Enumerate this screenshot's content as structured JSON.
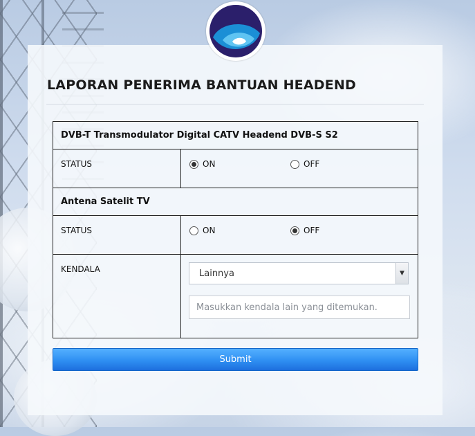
{
  "header": {
    "title": "LAPORAN PENERIMA BANTUAN HEADEND",
    "logo_icon": "kominfo-logo"
  },
  "sections": [
    {
      "title": "DVB-T Transmodulator Digital CATV Headend DVB-S S2",
      "status_label": "STATUS",
      "options": [
        {
          "label": "ON",
          "checked": true
        },
        {
          "label": "OFF",
          "checked": false
        }
      ]
    },
    {
      "title": "Antena Satelit TV",
      "status_label": "STATUS",
      "options": [
        {
          "label": "ON",
          "checked": false
        },
        {
          "label": "OFF",
          "checked": true
        }
      ],
      "kendala_label": "KENDALA",
      "kendala_select_value": "Lainnya",
      "kendala_input_placeholder": "Masukkan kendala lain yang ditemukan."
    }
  ],
  "submit_label": "Submit",
  "colors": {
    "submit_top": "#54b0ff",
    "submit_bottom": "#1d6fde",
    "logo_dark": "#2b1f6b",
    "logo_blue": "#1b8fd6"
  }
}
